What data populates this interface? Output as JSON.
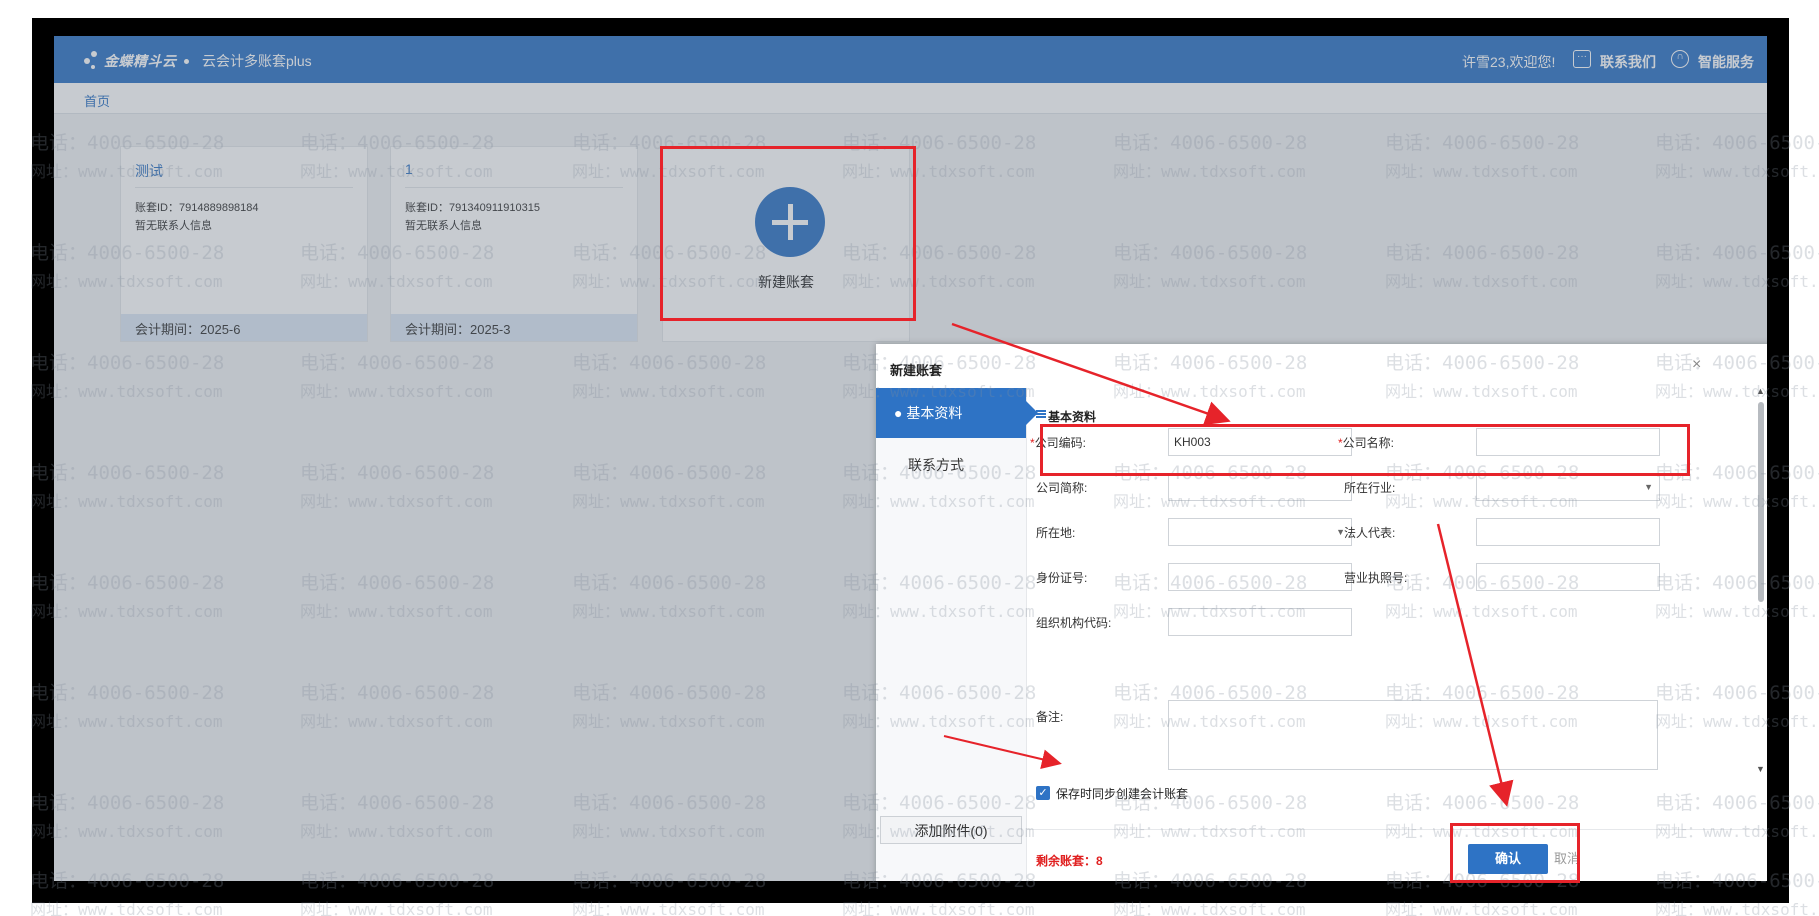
{
  "header": {
    "brand": "金蝶精斗云",
    "product": "云会计多账套plus",
    "greeting": "许雪23,欢迎您!",
    "contact_label": "联系我们",
    "service_label": "智能服务"
  },
  "breadcrumb": {
    "home": "首页"
  },
  "cards": [
    {
      "name": "测试",
      "id_text": "账套ID：7914889898184",
      "contact": "暂无联系人信息",
      "period": "会计期间：2025-6"
    },
    {
      "name": "1",
      "id_text": "账套ID：791340911910315",
      "contact": "暂无联系人信息",
      "period": "会计期间：2025-3"
    }
  ],
  "new_card": {
    "label": "新建账套"
  },
  "dialog": {
    "title": "新建账套",
    "close": "×",
    "sidebar": {
      "active": "● 基本资料",
      "contact": "联系方式",
      "attach": "添加附件(0)"
    },
    "section_title": "基本资料",
    "fields": {
      "company_code_label": "公司编码:",
      "company_code_value": "KH003",
      "company_name_label": "公司名称:",
      "short_name_label": "公司简称:",
      "industry_label": "所在行业:",
      "location_label": "所在地:",
      "legal_rep_label": "法人代表:",
      "id_card_label": "身份证号:",
      "license_label": "营业执照号:",
      "org_code_label": "组织机构代码:",
      "remark_label": "备注:"
    },
    "checkbox": {
      "label": "保存时同步创建会计账套",
      "checked": true
    },
    "footer": {
      "remaining": "剩余账套：8",
      "confirm": "确认",
      "cancel": "取消"
    }
  },
  "watermark": {
    "phone": "电话：4006-6500-28",
    "site": "网址：www.tdxsoft.com"
  },
  "colors": {
    "brand_blue": "#2e73c5",
    "annotation_red": "#e6232a"
  },
  "icons": {
    "contact": "chat-icon",
    "service": "headset-icon",
    "close": "close-icon",
    "plus": "plus-icon"
  }
}
